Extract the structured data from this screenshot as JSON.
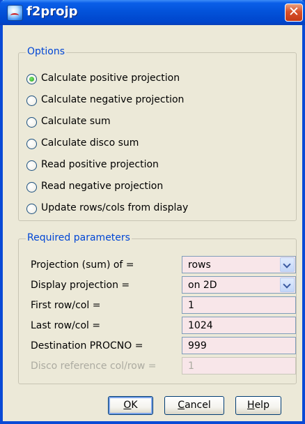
{
  "window": {
    "title": "f2projp",
    "close_glyph": "✕"
  },
  "options": {
    "title": "Options",
    "items": [
      {
        "label": "Calculate positive projection",
        "checked": true
      },
      {
        "label": "Calculate negative projection",
        "checked": false
      },
      {
        "label": "Calculate sum",
        "checked": false
      },
      {
        "label": "Calculate disco sum",
        "checked": false
      },
      {
        "label": "Read positive projection",
        "checked": false
      },
      {
        "label": "Read negative projection",
        "checked": false
      },
      {
        "label": "Update rows/cols from display",
        "checked": false
      }
    ]
  },
  "params": {
    "title": "Required parameters",
    "rows": [
      {
        "label": "Projection (sum) of =",
        "value": "rows",
        "type": "select",
        "enabled": true
      },
      {
        "label": "Display projection =",
        "value": "on 2D",
        "type": "select",
        "enabled": true
      },
      {
        "label": "First row/col =",
        "value": "1",
        "type": "text",
        "enabled": true
      },
      {
        "label": "Last row/col =",
        "value": "1024",
        "type": "text",
        "enabled": true
      },
      {
        "label": "Destination PROCNO =",
        "value": "999",
        "type": "text",
        "enabled": true
      },
      {
        "label": "Disco reference col/row =",
        "value": "1",
        "type": "text",
        "enabled": false
      }
    ]
  },
  "buttons": {
    "ok": {
      "mnemonic": "O",
      "rest": "K"
    },
    "cancel": {
      "mnemonic": "C",
      "rest": "ancel"
    },
    "help": {
      "mnemonic": "H",
      "rest": "elp"
    }
  }
}
